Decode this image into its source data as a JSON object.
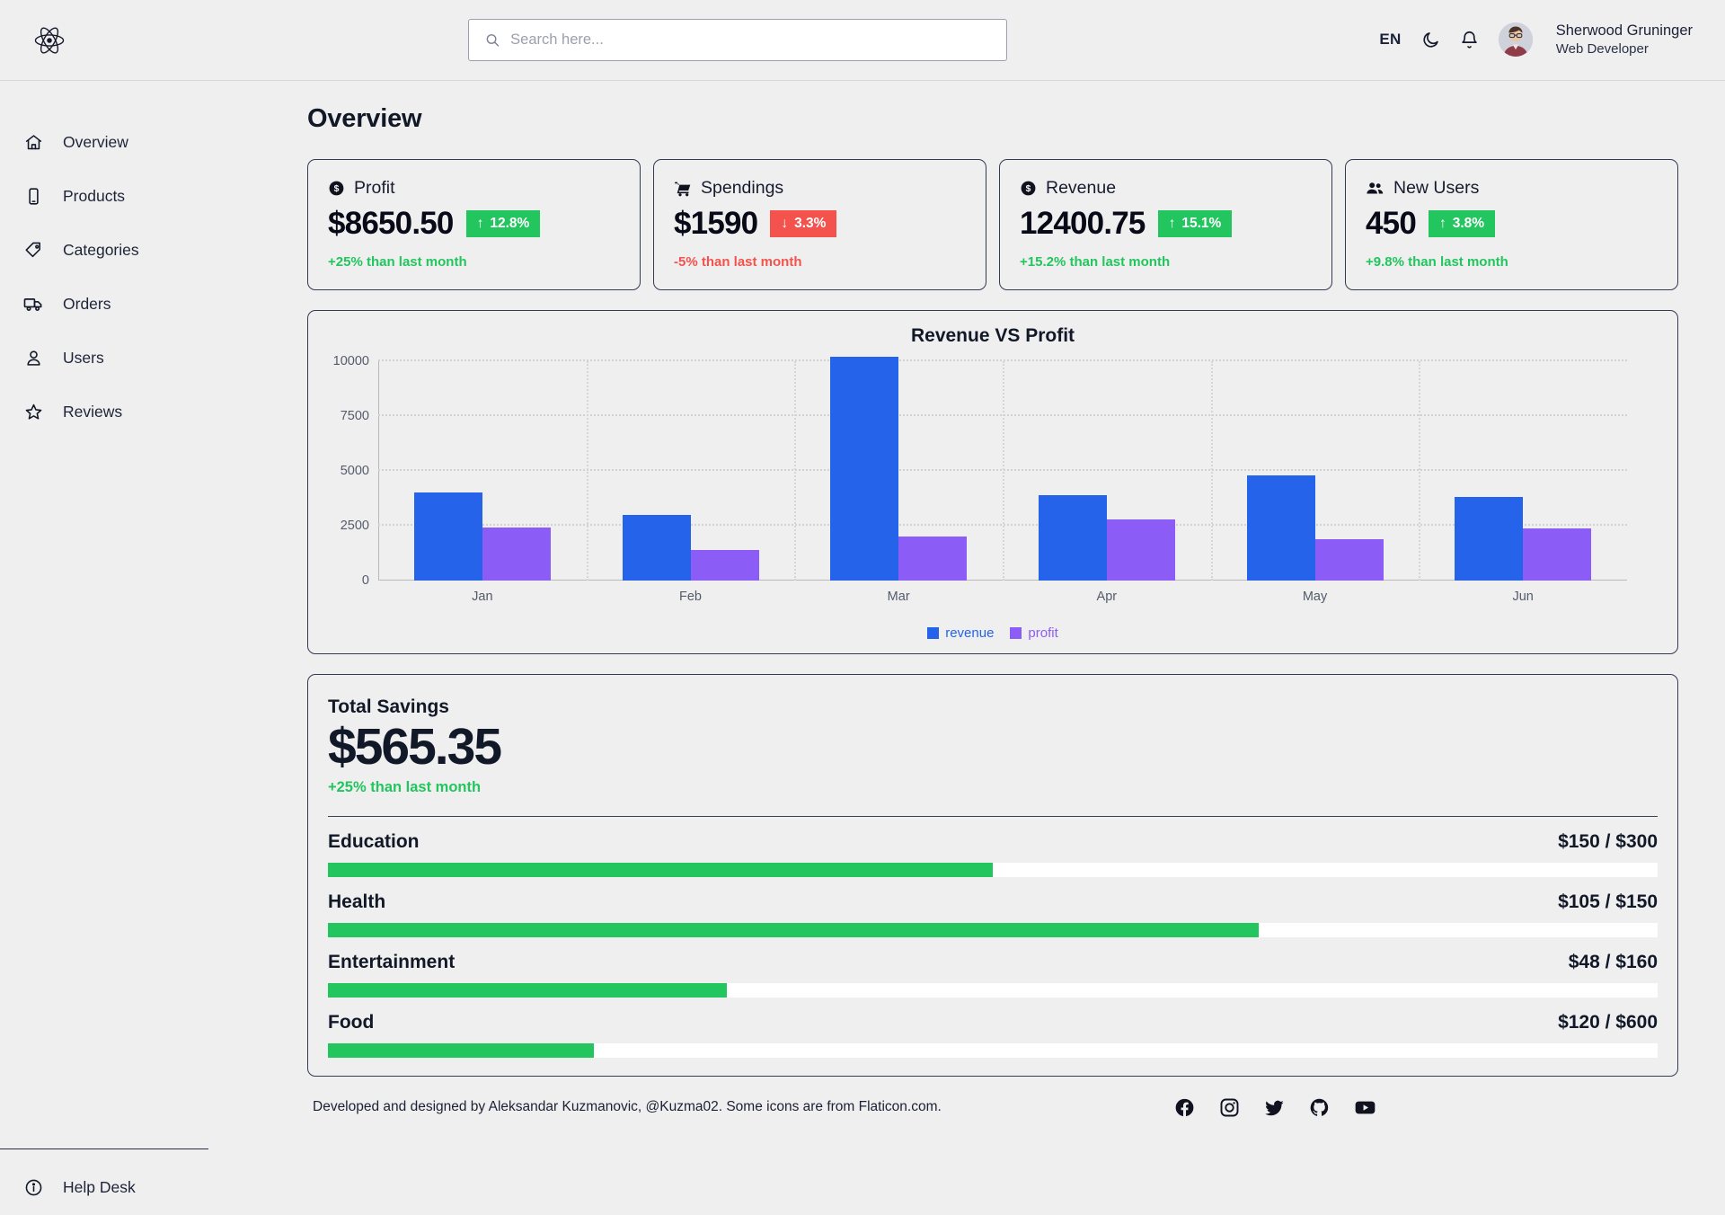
{
  "header": {
    "logo_icon": "react-atom-logo",
    "search": {
      "placeholder": "Search here...",
      "value": "",
      "icon": "search-icon"
    },
    "language": "EN",
    "theme_icon": "moon-icon",
    "notifications_icon": "bell-icon",
    "user": {
      "name": "Sherwood Gruninger",
      "role": "Web Developer",
      "avatar": "user-avatar"
    }
  },
  "sidebar": {
    "items": [
      {
        "label": "Overview",
        "icon": "home-icon"
      },
      {
        "label": "Products",
        "icon": "mobile-icon"
      },
      {
        "label": "Categories",
        "icon": "tag-icon"
      },
      {
        "label": "Orders",
        "icon": "truck-icon"
      },
      {
        "label": "Users",
        "icon": "user-icon"
      },
      {
        "label": "Reviews",
        "icon": "star-icon"
      }
    ],
    "help": {
      "label": "Help Desk",
      "icon": "info-icon"
    }
  },
  "main": {
    "page_title": "Overview",
    "cards": [
      {
        "title": "Profit",
        "icon": "dollar-coin-icon",
        "value": "$8650.50",
        "badge": "12.8%",
        "direction": "up",
        "arrow": "↑",
        "note": "+25% than last month",
        "note_kind": "pos"
      },
      {
        "title": "Spendings",
        "icon": "cart-icon",
        "value": "$1590",
        "badge": "3.3%",
        "direction": "down",
        "arrow": "↓",
        "note": "-5% than last month",
        "note_kind": "neg"
      },
      {
        "title": "Revenue",
        "icon": "dollar-coin-icon",
        "value": "12400.75",
        "badge": "15.1%",
        "direction": "up",
        "arrow": "↑",
        "note": "+15.2% than last month",
        "note_kind": "pos"
      },
      {
        "title": "New Users",
        "icon": "users-group-icon",
        "value": "450",
        "badge": "3.8%",
        "direction": "up",
        "arrow": "↑",
        "note": "+9.8% than last month",
        "note_kind": "pos"
      }
    ],
    "savings": {
      "title": "Total Savings",
      "amount": "$565.35",
      "note": "+25% than last month",
      "rows": [
        {
          "name": "Education",
          "value": "$150 / $300",
          "current": 150,
          "total": 300,
          "percent": 50
        },
        {
          "name": "Health",
          "value": "$105 / $150",
          "current": 105,
          "total": 150,
          "percent": 70
        },
        {
          "name": "Entertainment",
          "value": "$48 / $160",
          "current": 48,
          "total": 160,
          "percent": 30
        },
        {
          "name": "Food",
          "value": "$120 / $600",
          "current": 120,
          "total": 600,
          "percent": 20
        }
      ]
    }
  },
  "chart_data": {
    "type": "bar",
    "title": "Revenue VS Profit",
    "xlabel": "",
    "ylabel": "",
    "categories": [
      "Jan",
      "Feb",
      "Mar",
      "Apr",
      "May",
      "Jun"
    ],
    "series": [
      {
        "name": "revenue",
        "color": "#2563eb",
        "values": [
          4000,
          3000,
          10200,
          3900,
          4800,
          3800
        ]
      },
      {
        "name": "profit",
        "color": "#8b5cf6",
        "values": [
          2400,
          1398,
          2000,
          2780,
          1890,
          2390
        ]
      }
    ],
    "ylim": [
      0,
      10000
    ],
    "yticks": [
      0,
      2500,
      5000,
      7500,
      10000
    ],
    "ytick_labels": [
      "0",
      "2500",
      "5000",
      "7500",
      "10000"
    ],
    "grid": true,
    "legend_position": "bottom"
  },
  "footer": {
    "credit": "Developed and designed by Aleksandar Kuzmanovic, @Kuzma02. Some icons are from Flaticon.com.",
    "socials": [
      "facebook-icon",
      "instagram-icon",
      "twitter-icon",
      "github-icon",
      "youtube-icon"
    ]
  },
  "colors": {
    "accent_green": "#22c55e",
    "accent_red": "#f4524d",
    "revenue_blue": "#2563eb",
    "profit_purple": "#8b5cf6",
    "background": "#efefef"
  }
}
